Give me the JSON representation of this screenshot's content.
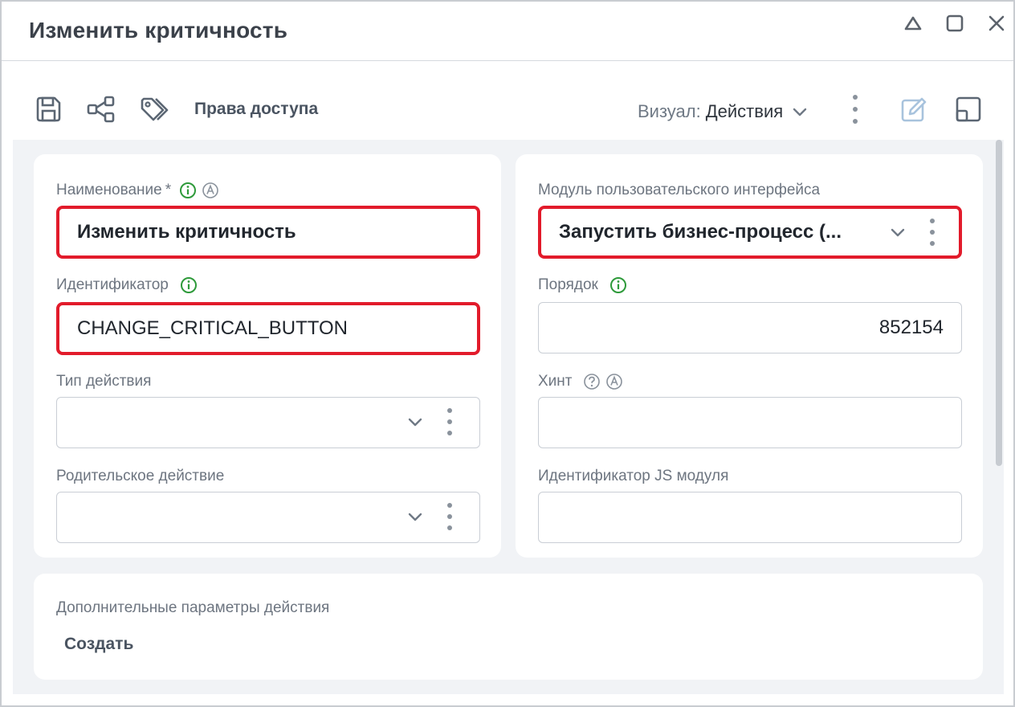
{
  "window": {
    "title": "Изменить критичность",
    "controls": [
      "collapse-icon",
      "maximize-icon",
      "close-icon"
    ]
  },
  "toolbar": {
    "icons": [
      "save-icon",
      "share-icon",
      "tags-icon"
    ],
    "access_rights_label": "Права доступа",
    "visual_label": "Визуал:",
    "visual_value": "Действия"
  },
  "left_card": {
    "name": {
      "label": "Наименование",
      "required_mark": "*",
      "value": "Изменить критичность",
      "icons": [
        "info-icon",
        "auto-icon"
      ]
    },
    "identifier": {
      "label": "Идентификатор",
      "value": "CHANGE_CRITICAL_BUTTON",
      "icons": [
        "info-icon"
      ]
    },
    "action_type": {
      "label": "Тип действия",
      "value": ""
    },
    "parent_action": {
      "label": "Родительское действие",
      "value": ""
    }
  },
  "right_card": {
    "ui_module": {
      "label": "Модуль пользовательского интерфейса",
      "value": "Запустить бизнес-процесс (..."
    },
    "order": {
      "label": "Порядок",
      "value": "852154",
      "icons": [
        "info-icon"
      ]
    },
    "hint": {
      "label": "Хинт",
      "value": "",
      "icons": [
        "help-icon",
        "auto-icon"
      ]
    },
    "js_module": {
      "label": "Идентификатор JS модуля",
      "value": ""
    }
  },
  "extra": {
    "title": "Дополнительные параметры действия",
    "create_label": "Создать"
  },
  "colors": {
    "highlight_border": "#e21b2b",
    "info_icon": "#2e9a3a",
    "panel_background": "#f1f3f6"
  }
}
